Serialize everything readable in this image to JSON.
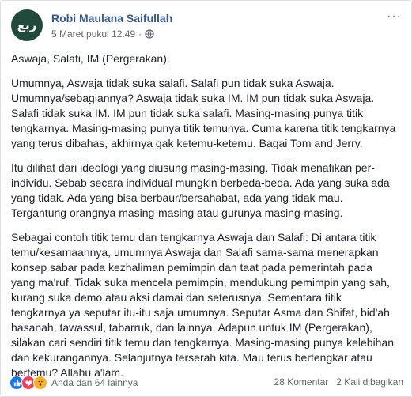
{
  "post": {
    "author": "Robi Maulana Saifullah",
    "avatar_text": "ربع",
    "timestamp": "5 Maret pukul 12.49",
    "separator": "·",
    "more_label": "···",
    "title_line": "Aswaja, Salafi, IM (Pergerakan).",
    "paragraphs": [
      [
        "Umumnya, Aswaja tidak suka salafi. Salafi pun tidak suka Aswaja.",
        "Umumnya/sebagiannya? Aswaja tidak suka IM. IM pun tidak suka Aswaja.",
        "Salafi tidak suka IM. IM pun tidak suka salafi. Masing-masing punya titik",
        "tengkarnya. Masing-masing punya titik temunya. Cuma karena titik tengkarnya",
        "yang terus dibahas, akhirnya gak ketemu-ketemu. Bagai Tom and Jerry."
      ],
      [
        "Itu dilihat dari ideologi yang diusung masing-masing. Tidak menafikan per-",
        "individu. Sebab secara individual mungkin berbeda-beda. Ada yang suka ada",
        "yang tidak. Ada yang bisa berbaur/bersahabat, ada yang tidak mau.",
        "Tergantung orangnya masing-masing atau gurunya masing-masing."
      ],
      [
        "Sebagai contoh titik temu dan tengkarnya Aswaja dan Salafi: Di antara titik",
        "temu/kesamaannya, umumnya Aswaja dan Salafi sama-sama menerapkan",
        "konsep sabar pada kezhaliman pemimpin dan taat pada pemerintah pada",
        "yang ma'ruf. Tidak suka mencela pemimpin, mendukung pemimpin yang sah,",
        "kurang suka demo atau aksi damai dan seterusnya. Sementara titik",
        "tengkarnya ya seputar itu-itu saja umumnya. Seputar Asma dan Shifat, bid'ah",
        "hasanah, tawassul, tabarruk, dan lainnya. Adapun untuk IM (Pergerakan),",
        "silakan cari sendiri titik temu dan tengkarnya. Masing-masing punya kelebihan",
        "dan kekurangannya. Selanjutnya terserah kita. Mau terus bertengkar atau",
        "bertemu? Allahu a'lam."
      ]
    ]
  },
  "footer": {
    "reactions_text": "Anda dan 64 lainnya",
    "comments": "28 Komentar",
    "shares": "2 Kali dibagikan",
    "reaction_icons": [
      "like-icon",
      "love-icon",
      "wow-icon"
    ]
  },
  "colors": {
    "link": "#365899",
    "text": "#1d2129",
    "meta": "#616770",
    "avatar_bg": "#1f4a3c",
    "like": "#1877f2",
    "love": "#f33e58",
    "wow": "#f7b125"
  }
}
